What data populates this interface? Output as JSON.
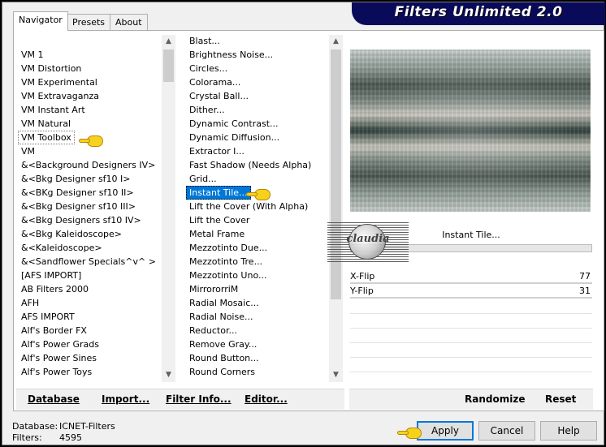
{
  "app": {
    "title": "Filters Unlimited 2.0"
  },
  "tabs": [
    {
      "label": "Navigator",
      "active": true
    },
    {
      "label": "Presets",
      "active": false
    },
    {
      "label": "About",
      "active": false
    }
  ],
  "categories": [
    "VM 1",
    "VM Distortion",
    "VM Experimental",
    "VM Extravaganza",
    "VM Instant Art",
    "VM Natural",
    "VM Toolbox",
    "VM",
    "&<Background Designers IV>",
    "&<Bkg Designer sf10 I>",
    "&<BKg Designer sf10 II>",
    "&<Bkg Designer sf10 III>",
    "&<Bkg Designers sf10 IV>",
    "&<Bkg Kaleidoscope>",
    "&<Kaleidoscope>",
    "&<Sandflower Specials^v^ >",
    "[AFS IMPORT]",
    "AB Filters 2000",
    "AFH",
    "AFS IMPORT",
    "Alf's Border FX",
    "Alf's Power Grads",
    "Alf's Power Sines",
    "Alf's Power Toys"
  ],
  "filters": [
    "Blast...",
    "Brightness Noise...",
    "Circles...",
    "Colorama...",
    "Crystal Ball...",
    "Dither...",
    "Dynamic Contrast...",
    "Dynamic Diffusion...",
    "Extractor I...",
    "Fast Shadow (Needs Alpha)",
    "Grid...",
    "Instant Tile...",
    "Lift the Cover (With Alpha)",
    "Lift the Cover",
    "Metal Frame",
    "Mezzotinto Due...",
    "Mezzotinto Tre...",
    "Mezzotinto Uno...",
    "MirrororriM",
    "Radial Mosaic...",
    "Radial Noise...",
    "Reductor...",
    "Remove Gray...",
    "Round Button...",
    "Round Corners"
  ],
  "selected_category_index": 6,
  "selected_filter_index": 11,
  "filter_panel": {
    "name": "Instant Tile...",
    "params": [
      {
        "label": "X-Flip",
        "value": "77"
      },
      {
        "label": "Y-Flip",
        "value": "31"
      }
    ]
  },
  "bottom_links": {
    "database": "Database",
    "import": "Import...",
    "filter_info": "Filter Info...",
    "editor": "Editor...",
    "randomize": "Randomize",
    "reset": "Reset"
  },
  "status": {
    "database_label": "Database:",
    "database_value": "ICNET-Filters",
    "filters_label": "Filters:",
    "filters_value": "4595"
  },
  "buttons": {
    "apply": "Apply",
    "cancel": "Cancel",
    "help": "Help"
  },
  "watermark": {
    "text": "claudia"
  },
  "colors": {
    "selection": "#0078d7",
    "banner": "#0a0a5a",
    "pointer": "#f7d21c"
  }
}
